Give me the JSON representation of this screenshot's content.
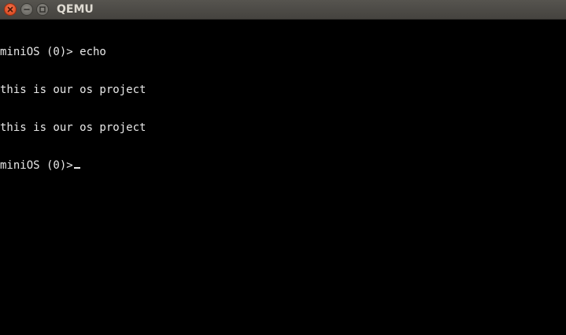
{
  "window": {
    "title": "QEMU",
    "buttons": {
      "close_icon": "close-icon",
      "minimize_icon": "minimize-icon",
      "maximize_icon": "maximize-icon"
    },
    "colors": {
      "titlebar": "#4b4944",
      "title_text": "#dfdbd2",
      "close_button": "#e2532a",
      "screen_background": "#000000",
      "console_text": "#e8e8e8"
    }
  },
  "console": {
    "lines": [
      "miniOS (0)> echo",
      "this is our os project",
      "this is our os project"
    ],
    "prompt": "miniOS (0)>"
  }
}
